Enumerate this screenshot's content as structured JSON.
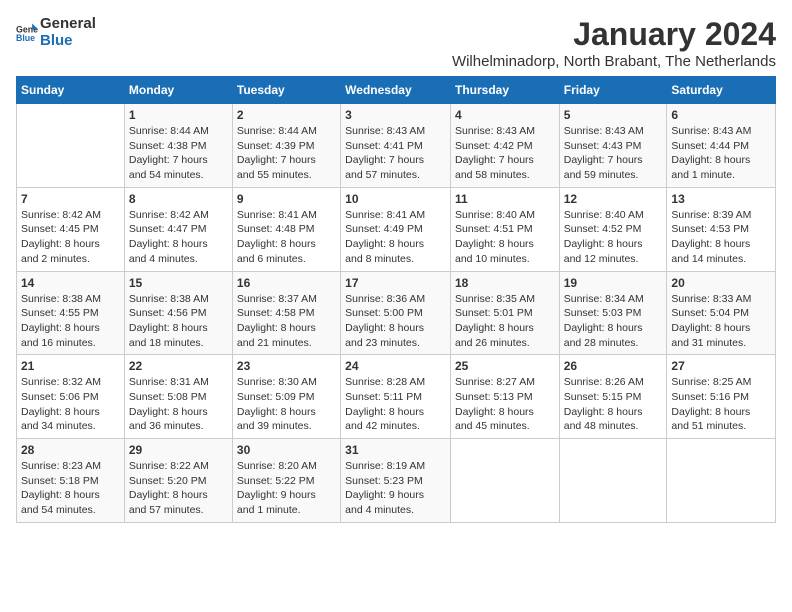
{
  "logo": {
    "text_general": "General",
    "text_blue": "Blue"
  },
  "title": "January 2024",
  "subtitle": "Wilhelminadorp, North Brabant, The Netherlands",
  "days_of_week": [
    "Sunday",
    "Monday",
    "Tuesday",
    "Wednesday",
    "Thursday",
    "Friday",
    "Saturday"
  ],
  "weeks": [
    [
      {
        "day": "",
        "content": ""
      },
      {
        "day": "1",
        "content": "Sunrise: 8:44 AM\nSunset: 4:38 PM\nDaylight: 7 hours\nand 54 minutes."
      },
      {
        "day": "2",
        "content": "Sunrise: 8:44 AM\nSunset: 4:39 PM\nDaylight: 7 hours\nand 55 minutes."
      },
      {
        "day": "3",
        "content": "Sunrise: 8:43 AM\nSunset: 4:41 PM\nDaylight: 7 hours\nand 57 minutes."
      },
      {
        "day": "4",
        "content": "Sunrise: 8:43 AM\nSunset: 4:42 PM\nDaylight: 7 hours\nand 58 minutes."
      },
      {
        "day": "5",
        "content": "Sunrise: 8:43 AM\nSunset: 4:43 PM\nDaylight: 7 hours\nand 59 minutes."
      },
      {
        "day": "6",
        "content": "Sunrise: 8:43 AM\nSunset: 4:44 PM\nDaylight: 8 hours\nand 1 minute."
      }
    ],
    [
      {
        "day": "7",
        "content": "Sunrise: 8:42 AM\nSunset: 4:45 PM\nDaylight: 8 hours\nand 2 minutes."
      },
      {
        "day": "8",
        "content": "Sunrise: 8:42 AM\nSunset: 4:47 PM\nDaylight: 8 hours\nand 4 minutes."
      },
      {
        "day": "9",
        "content": "Sunrise: 8:41 AM\nSunset: 4:48 PM\nDaylight: 8 hours\nand 6 minutes."
      },
      {
        "day": "10",
        "content": "Sunrise: 8:41 AM\nSunset: 4:49 PM\nDaylight: 8 hours\nand 8 minutes."
      },
      {
        "day": "11",
        "content": "Sunrise: 8:40 AM\nSunset: 4:51 PM\nDaylight: 8 hours\nand 10 minutes."
      },
      {
        "day": "12",
        "content": "Sunrise: 8:40 AM\nSunset: 4:52 PM\nDaylight: 8 hours\nand 12 minutes."
      },
      {
        "day": "13",
        "content": "Sunrise: 8:39 AM\nSunset: 4:53 PM\nDaylight: 8 hours\nand 14 minutes."
      }
    ],
    [
      {
        "day": "14",
        "content": "Sunrise: 8:38 AM\nSunset: 4:55 PM\nDaylight: 8 hours\nand 16 minutes."
      },
      {
        "day": "15",
        "content": "Sunrise: 8:38 AM\nSunset: 4:56 PM\nDaylight: 8 hours\nand 18 minutes."
      },
      {
        "day": "16",
        "content": "Sunrise: 8:37 AM\nSunset: 4:58 PM\nDaylight: 8 hours\nand 21 minutes."
      },
      {
        "day": "17",
        "content": "Sunrise: 8:36 AM\nSunset: 5:00 PM\nDaylight: 8 hours\nand 23 minutes."
      },
      {
        "day": "18",
        "content": "Sunrise: 8:35 AM\nSunset: 5:01 PM\nDaylight: 8 hours\nand 26 minutes."
      },
      {
        "day": "19",
        "content": "Sunrise: 8:34 AM\nSunset: 5:03 PM\nDaylight: 8 hours\nand 28 minutes."
      },
      {
        "day": "20",
        "content": "Sunrise: 8:33 AM\nSunset: 5:04 PM\nDaylight: 8 hours\nand 31 minutes."
      }
    ],
    [
      {
        "day": "21",
        "content": "Sunrise: 8:32 AM\nSunset: 5:06 PM\nDaylight: 8 hours\nand 34 minutes."
      },
      {
        "day": "22",
        "content": "Sunrise: 8:31 AM\nSunset: 5:08 PM\nDaylight: 8 hours\nand 36 minutes."
      },
      {
        "day": "23",
        "content": "Sunrise: 8:30 AM\nSunset: 5:09 PM\nDaylight: 8 hours\nand 39 minutes."
      },
      {
        "day": "24",
        "content": "Sunrise: 8:28 AM\nSunset: 5:11 PM\nDaylight: 8 hours\nand 42 minutes."
      },
      {
        "day": "25",
        "content": "Sunrise: 8:27 AM\nSunset: 5:13 PM\nDaylight: 8 hours\nand 45 minutes."
      },
      {
        "day": "26",
        "content": "Sunrise: 8:26 AM\nSunset: 5:15 PM\nDaylight: 8 hours\nand 48 minutes."
      },
      {
        "day": "27",
        "content": "Sunrise: 8:25 AM\nSunset: 5:16 PM\nDaylight: 8 hours\nand 51 minutes."
      }
    ],
    [
      {
        "day": "28",
        "content": "Sunrise: 8:23 AM\nSunset: 5:18 PM\nDaylight: 8 hours\nand 54 minutes."
      },
      {
        "day": "29",
        "content": "Sunrise: 8:22 AM\nSunset: 5:20 PM\nDaylight: 8 hours\nand 57 minutes."
      },
      {
        "day": "30",
        "content": "Sunrise: 8:20 AM\nSunset: 5:22 PM\nDaylight: 9 hours\nand 1 minute."
      },
      {
        "day": "31",
        "content": "Sunrise: 8:19 AM\nSunset: 5:23 PM\nDaylight: 9 hours\nand 4 minutes."
      },
      {
        "day": "",
        "content": ""
      },
      {
        "day": "",
        "content": ""
      },
      {
        "day": "",
        "content": ""
      }
    ]
  ]
}
